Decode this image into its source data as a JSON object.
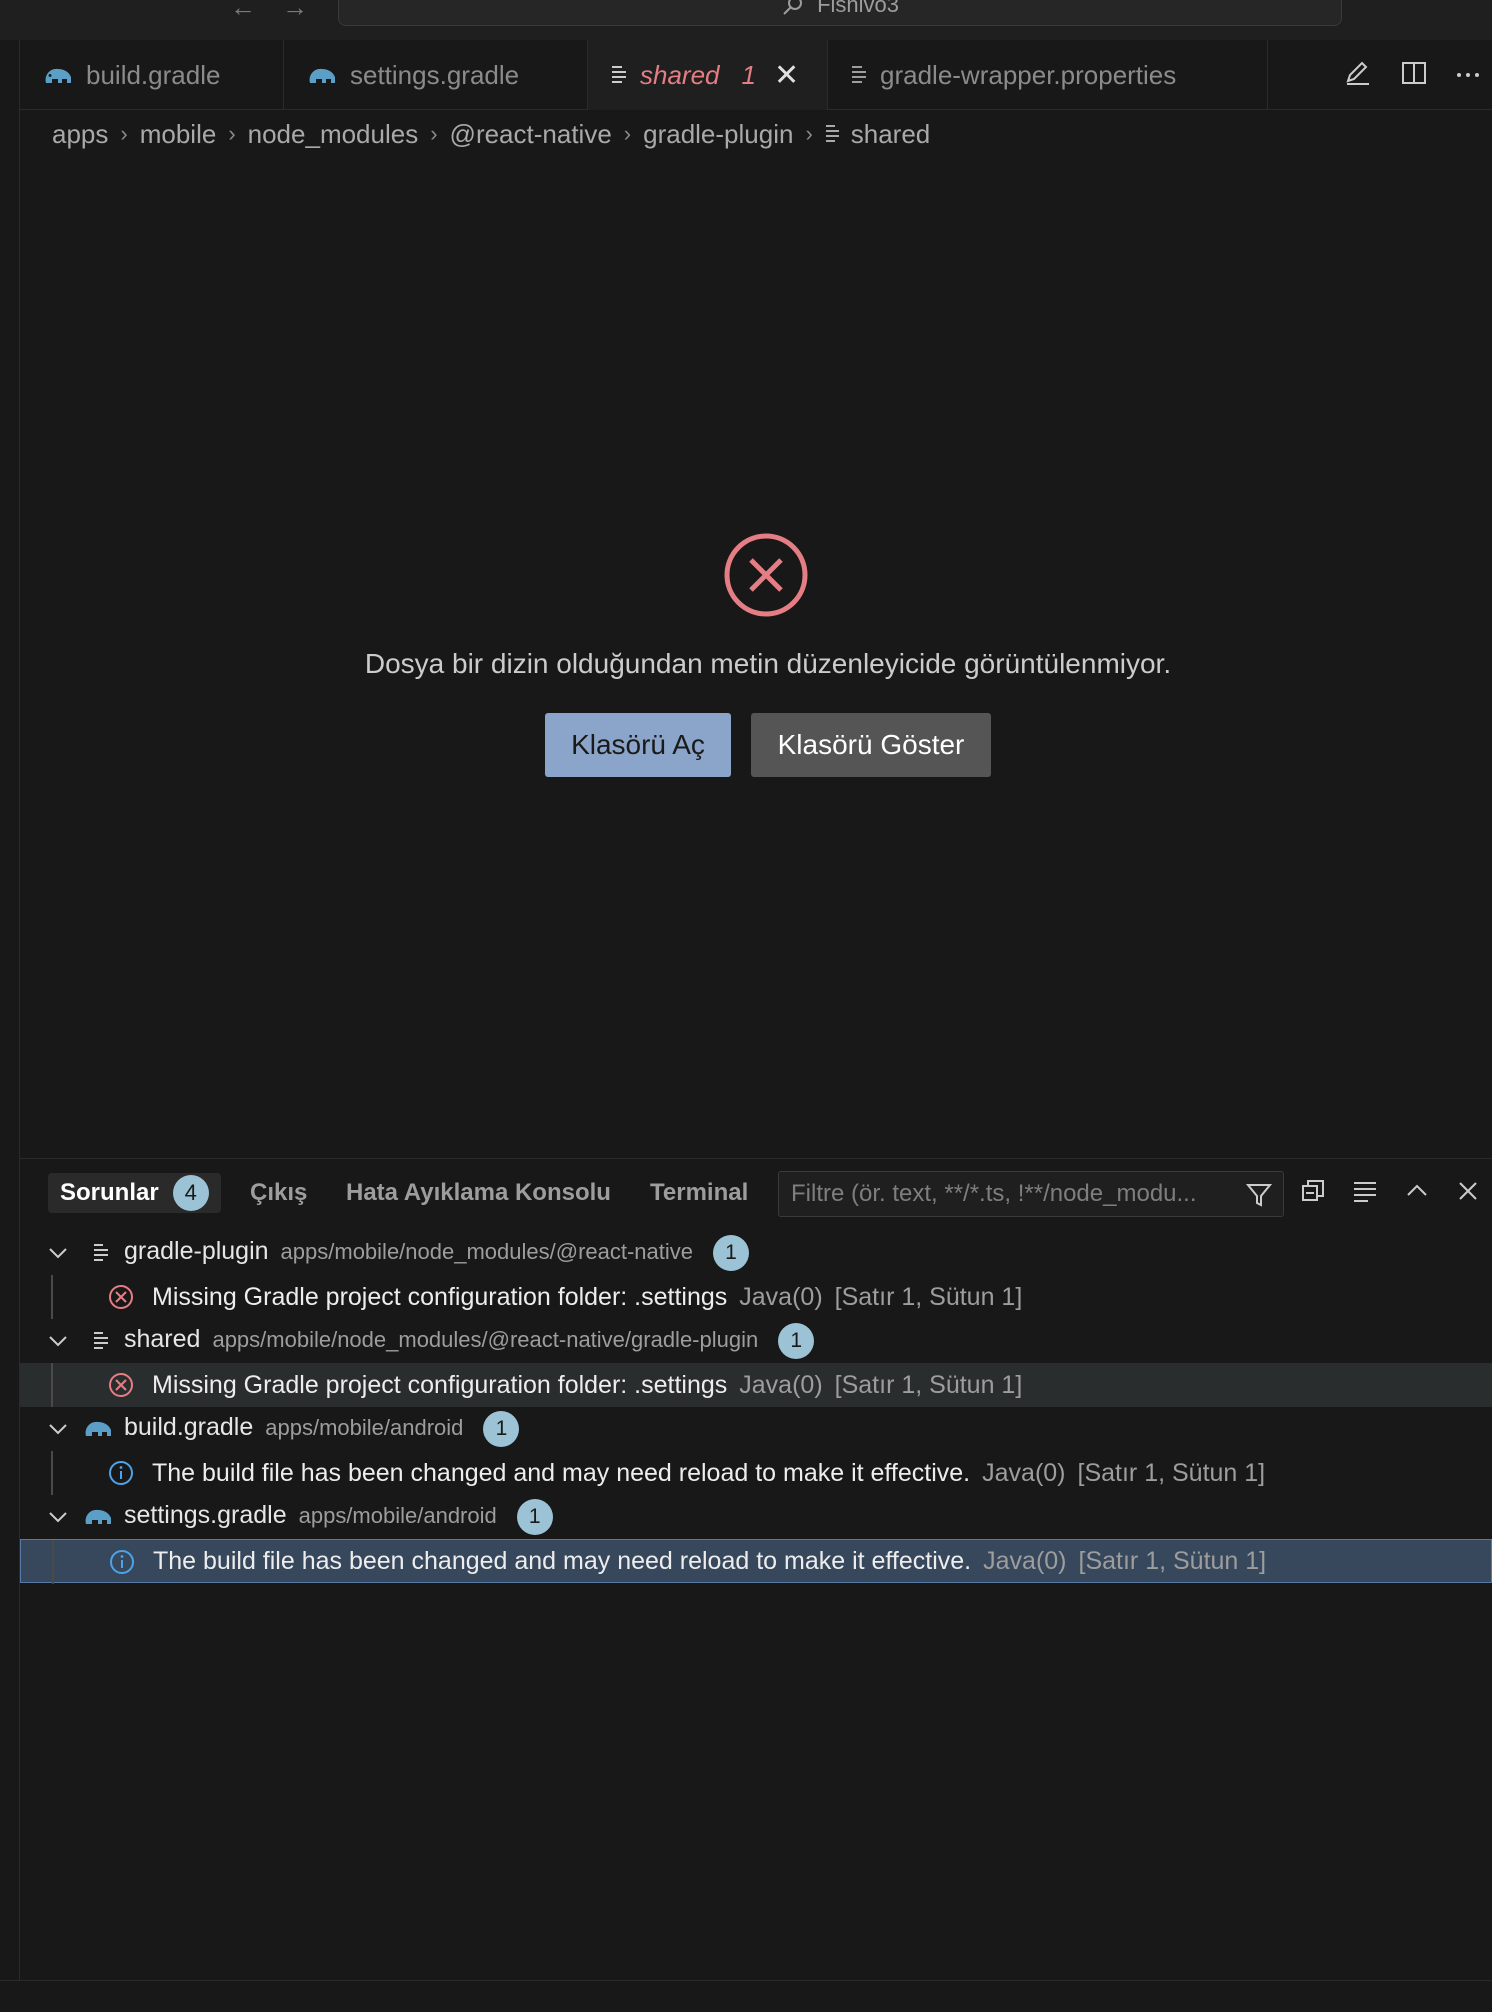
{
  "window": {
    "title": "Fishivo3"
  },
  "tabs": [
    {
      "label": "build.gradle",
      "icon": "gradle-elephant-icon"
    },
    {
      "label": "settings.gradle",
      "icon": "gradle-elephant-icon"
    },
    {
      "label": "shared",
      "icon": "file-lines-icon",
      "problems": "1",
      "active": true
    },
    {
      "label": "gradle-wrapper.properties",
      "icon": "file-lines-icon"
    }
  ],
  "breadcrumb": [
    "apps",
    "mobile",
    "node_modules",
    "@react-native",
    "gradle-plugin",
    "shared"
  ],
  "editor": {
    "message": "Dosya bir dizin olduğundan metin düzenleyicide görüntülenmiyor.",
    "primary_button": "Klasörü Aç",
    "secondary_button": "Klasörü Göster"
  },
  "panel": {
    "tabs": [
      {
        "label": "Sorunlar",
        "badge": "4",
        "active": true
      },
      {
        "label": "Çıkış"
      },
      {
        "label": "Hata Ayıklama Konsolu"
      },
      {
        "label": "Terminal"
      }
    ],
    "filter_placeholder": "Filtre (ör. text, **/*.ts, !**/node_modu...",
    "groups": [
      {
        "name": "gradle-plugin",
        "path": "apps/mobile/node_modules/@react-native",
        "count": "1",
        "icon": "file-lines-icon",
        "problem": {
          "severity": "error",
          "message": "Missing Gradle project configuration folder: .settings",
          "source": "Java(0)",
          "location": "[Satır 1, Sütun 1]"
        }
      },
      {
        "name": "shared",
        "path": "apps/mobile/node_modules/@react-native/gradle-plugin",
        "count": "1",
        "icon": "file-lines-icon",
        "problem": {
          "severity": "error",
          "message": "Missing Gradle project configuration folder: .settings",
          "source": "Java(0)",
          "location": "[Satır 1, Sütun 1]"
        }
      },
      {
        "name": "build.gradle",
        "path": "apps/mobile/android",
        "count": "1",
        "icon": "gradle-elephant-icon",
        "problem": {
          "severity": "info",
          "message": "The build file has been changed and may need reload to make it effective.",
          "source": "Java(0)",
          "location": "[Satır 1, Sütun 1]"
        }
      },
      {
        "name": "settings.gradle",
        "path": "apps/mobile/android",
        "count": "1",
        "icon": "gradle-elephant-icon",
        "problem": {
          "severity": "info",
          "message": "The build file has been changed and may need reload to make it effective.",
          "source": "Java(0)",
          "location": "[Satır 1, Sütun 1]"
        }
      }
    ]
  },
  "colors": {
    "error": "#e57e84",
    "info": "#4da3e8",
    "badge": "#9cc3d5",
    "button_primary": "#8aa5c9"
  }
}
